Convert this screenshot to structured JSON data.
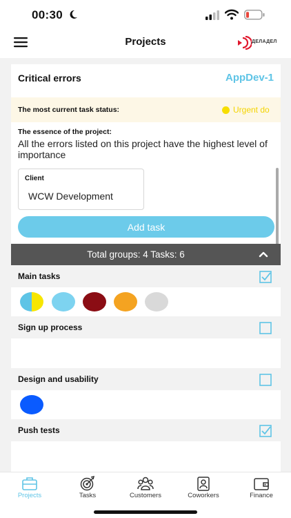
{
  "status_bar": {
    "time": "00:30"
  },
  "header": {
    "title": "Projects",
    "logo_text": "ДЕЛАДЕЛ"
  },
  "project": {
    "name": "Critical errors",
    "code": "AppDev-1",
    "status_label": "The most current task status:",
    "status_value": "Urgent do",
    "essence_label": "The essence of the project:",
    "essence_text": "All the errors listed on this project have the highest level of importance",
    "client_label": "Client",
    "client_value": "WCW Development",
    "add_task_label": "Add task"
  },
  "summary": {
    "text": "Total groups: 4   Tasks: 6"
  },
  "groups": [
    {
      "title": "Main tasks",
      "checked": true,
      "task_colors": [
        "#5ec4e6",
        "#7dd3f0",
        "#8b0d14",
        "#f4a321",
        "#d9d9d9"
      ]
    },
    {
      "title": "Sign up process",
      "checked": false,
      "task_colors": []
    },
    {
      "title": "Design and usability",
      "checked": false,
      "task_colors": [
        "#0a5bff"
      ]
    },
    {
      "title": "Push tests",
      "checked": true,
      "task_colors": []
    }
  ],
  "tabs": [
    {
      "label": "Projects",
      "icon": "briefcase-icon",
      "active": true
    },
    {
      "label": "Tasks",
      "icon": "target-icon",
      "active": false
    },
    {
      "label": "Customers",
      "icon": "customers-icon",
      "active": false
    },
    {
      "label": "Coworkers",
      "icon": "badge-icon",
      "active": false
    },
    {
      "label": "Finance",
      "icon": "wallet-icon",
      "active": false
    }
  ],
  "colors": {
    "accent": "#5ec4e6",
    "status_urgent": "#f4d400",
    "summary_bar": "#555555"
  }
}
